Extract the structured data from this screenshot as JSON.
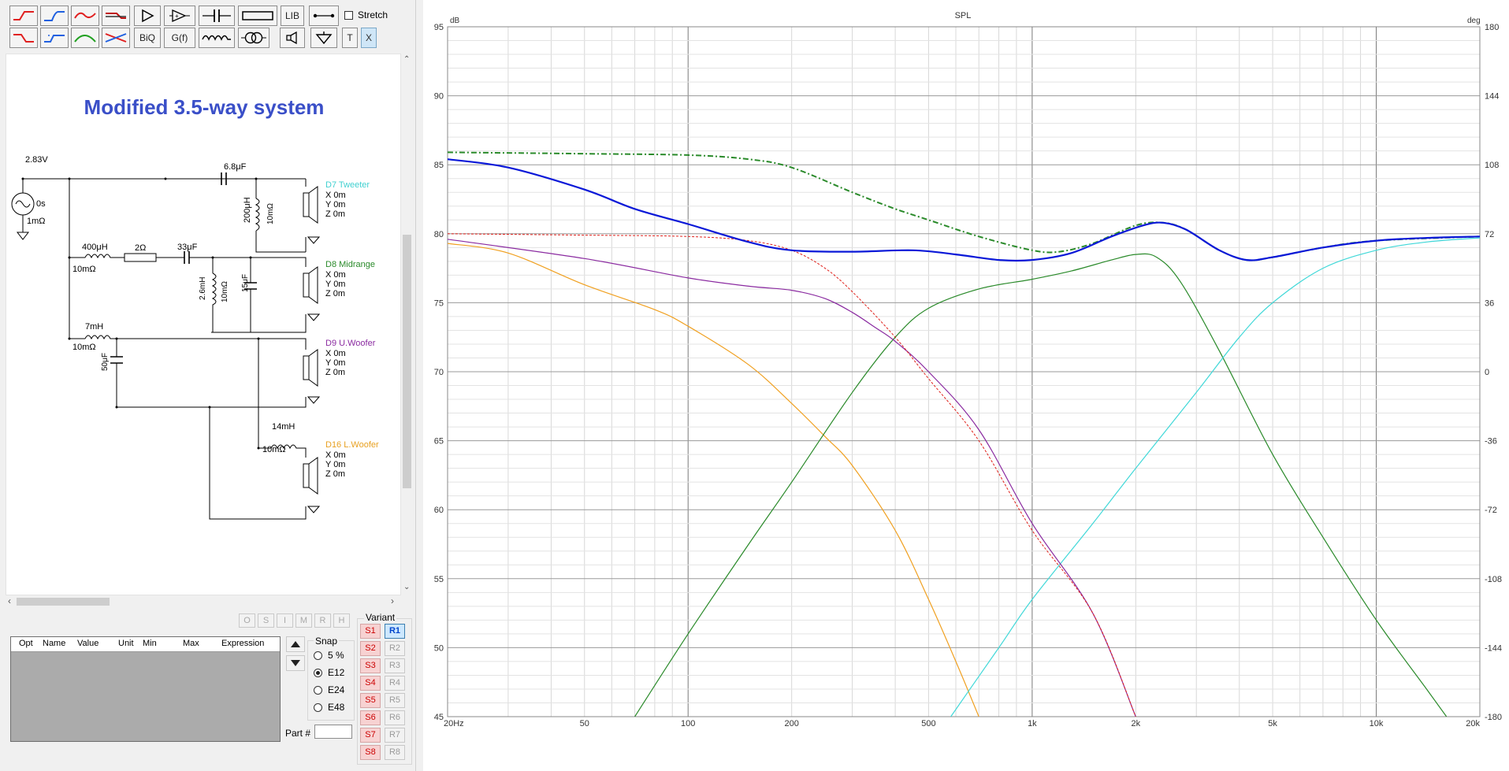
{
  "toolbar": {
    "stretch_label": "Stretch",
    "lib_label": "LIB",
    "biq_label": "BiQ",
    "gf_label": "G(f)",
    "t_label": "T",
    "x_label": "X",
    "row1_icons": [
      "highpass-icon",
      "lowpass-icon",
      "bandpass-icon",
      "shelf-icon",
      "amplifier-icon",
      "buffer-amplifier-icon",
      "capacitor-icon",
      "resistor-icon"
    ],
    "row2_icons": [
      "highpass-2-icon",
      "lowpass-2-icon",
      "bandpass-2-icon",
      "notch-icon"
    ]
  },
  "schematic": {
    "title": "Modified 3.5-way system",
    "source_voltage": "2.83V",
    "source_delay": "0s",
    "source_resistance": "1mΩ",
    "tweeter": {
      "cap": "6.8μF",
      "ind": "200μH",
      "ind_r": "10mΩ",
      "driver": "D7 Tweeter",
      "x": "X 0m",
      "y": "Y 0m",
      "z": "Z 0m",
      "color": "#40d0d0"
    },
    "midrange": {
      "ind": "400μH",
      "ind_r": "10mΩ",
      "res": "2Ω",
      "cap": "33μF",
      "shunt_ind": "2.6mH",
      "shunt_ind_r": "10mΩ",
      "shunt_cap": "15μF",
      "driver": "D8 Midrange",
      "x": "X 0m",
      "y": "Y 0m",
      "z": "Z 0m",
      "color": "#2a8a2a"
    },
    "uwoofer": {
      "ind": "7mH",
      "ind_r": "10mΩ",
      "cap": "50μF",
      "driver": "D9 U.Woofer",
      "x": "X 0m",
      "y": "Y 0m",
      "z": "Z 0m",
      "color": "#8a2aa0"
    },
    "lwoofer": {
      "ind": "14mH",
      "ind_r": "10mΩ",
      "driver": "D16 L.Woofer",
      "x": "X 0m",
      "y": "Y 0m",
      "z": "Z 0m",
      "color": "#e8a020"
    }
  },
  "lower": {
    "osimrh": [
      "O",
      "S",
      "I",
      "M",
      "R",
      "H"
    ],
    "columns": [
      "Opt",
      "Name",
      "Value",
      "Unit",
      "Min",
      "Max",
      "Expression"
    ],
    "snap_title": "Snap",
    "snap_options": [
      "5 %",
      "E12",
      "E24",
      "E48"
    ],
    "snap_selected": "E12",
    "part_label": "Part #",
    "part_value": "",
    "variant_title": "Variant",
    "variants_s": [
      "S1",
      "S2",
      "S3",
      "S4",
      "S5",
      "S6",
      "S7",
      "S8"
    ],
    "variants_r": [
      "R1",
      "R2",
      "R3",
      "R4",
      "R5",
      "R6",
      "R7",
      "R8"
    ],
    "active_variant": "R1"
  },
  "chart_data": {
    "type": "line",
    "title": "SPL",
    "ylabel": "dB",
    "y2label": "deg",
    "xscale": "log",
    "xlim": [
      20,
      20000
    ],
    "ylim": [
      45,
      95
    ],
    "y2lim": [
      -180,
      180
    ],
    "x_ticks": [
      20,
      50,
      100,
      200,
      500,
      1000,
      2000,
      5000,
      10000,
      20000
    ],
    "x_tick_labels": [
      "20Hz",
      "50",
      "100",
      "200",
      "500",
      "1k",
      "2k",
      "5k",
      "10k",
      "20k"
    ],
    "y_ticks": [
      45,
      50,
      55,
      60,
      65,
      70,
      75,
      80,
      85,
      90,
      95
    ],
    "y2_ticks": [
      -180,
      -144,
      -108,
      -72,
      -36,
      0,
      36,
      72,
      108,
      144,
      180
    ],
    "grid": true,
    "series": [
      {
        "color": "#0a18d8",
        "width": 2.2,
        "dash": "",
        "points": [
          [
            20,
            85.4
          ],
          [
            30,
            84.8
          ],
          [
            50,
            83.2
          ],
          [
            70,
            81.8
          ],
          [
            100,
            80.7
          ],
          [
            150,
            79.4
          ],
          [
            200,
            78.8
          ],
          [
            300,
            78.7
          ],
          [
            450,
            78.8
          ],
          [
            600,
            78.5
          ],
          [
            800,
            78.1
          ],
          [
            1000,
            78.1
          ],
          [
            1300,
            78.6
          ],
          [
            1700,
            79.8
          ],
          [
            2100,
            80.6
          ],
          [
            2400,
            80.8
          ],
          [
            2800,
            80.3
          ],
          [
            3500,
            78.8
          ],
          [
            4200,
            78.1
          ],
          [
            5000,
            78.3
          ],
          [
            7000,
            79.0
          ],
          [
            10000,
            79.5
          ],
          [
            14000,
            79.7
          ],
          [
            20000,
            79.8
          ]
        ]
      },
      {
        "color": "#2a8a2a",
        "width": 2,
        "dash": "7,3,2,3",
        "points": [
          [
            20,
            85.9
          ],
          [
            50,
            85.8
          ],
          [
            100,
            85.7
          ],
          [
            150,
            85.4
          ],
          [
            200,
            84.8
          ],
          [
            300,
            83.0
          ],
          [
            400,
            81.8
          ],
          [
            500,
            81.0
          ],
          [
            700,
            79.8
          ],
          [
            1000,
            78.8
          ],
          [
            1200,
            78.7
          ],
          [
            1500,
            79.3
          ],
          [
            2000,
            80.6
          ],
          [
            2400,
            80.8
          ],
          [
            2800,
            80.3
          ],
          [
            3500,
            78.8
          ],
          [
            4200,
            78.1
          ],
          [
            5000,
            78.3
          ],
          [
            7000,
            79.0
          ],
          [
            10000,
            79.5
          ],
          [
            20000,
            79.8
          ]
        ]
      },
      {
        "color": "#e0201a",
        "width": 1,
        "dash": "3,2",
        "points": [
          [
            20,
            80.0
          ],
          [
            50,
            79.9
          ],
          [
            100,
            79.8
          ],
          [
            150,
            79.5
          ],
          [
            200,
            78.8
          ],
          [
            250,
            77.5
          ],
          [
            300,
            75.8
          ],
          [
            400,
            72.5
          ],
          [
            500,
            69.5
          ],
          [
            700,
            65.0
          ],
          [
            1000,
            58.5
          ],
          [
            1500,
            52.5
          ],
          [
            2000,
            45
          ]
        ]
      },
      {
        "color": "#8a2aa0",
        "width": 1.2,
        "dash": "",
        "points": [
          [
            20,
            79.6
          ],
          [
            50,
            78.2
          ],
          [
            100,
            76.8
          ],
          [
            150,
            76.2
          ],
          [
            200,
            75.9
          ],
          [
            250,
            75.3
          ],
          [
            300,
            74.3
          ],
          [
            350,
            73.2
          ],
          [
            400,
            72.2
          ],
          [
            500,
            70.0
          ],
          [
            700,
            65.8
          ],
          [
            1000,
            59.0
          ],
          [
            1500,
            52.5
          ],
          [
            2000,
            45
          ]
        ]
      },
      {
        "color": "#f0a020",
        "width": 1.2,
        "dash": "",
        "points": [
          [
            20,
            79.3
          ],
          [
            30,
            78.6
          ],
          [
            50,
            76.3
          ],
          [
            80,
            74.5
          ],
          [
            100,
            73.3
          ],
          [
            150,
            70.5
          ],
          [
            200,
            67.7
          ],
          [
            250,
            65.3
          ],
          [
            300,
            63.2
          ],
          [
            400,
            58.5
          ],
          [
            500,
            53.5
          ],
          [
            600,
            49.0
          ],
          [
            700,
            45
          ]
        ]
      },
      {
        "color": "#2a8a2a",
        "width": 1.2,
        "dash": "",
        "points": [
          [
            70,
            45
          ],
          [
            100,
            51.0
          ],
          [
            150,
            57.5
          ],
          [
            200,
            62.0
          ],
          [
            300,
            68.5
          ],
          [
            400,
            72.5
          ],
          [
            500,
            74.6
          ],
          [
            700,
            76.0
          ],
          [
            1000,
            76.7
          ],
          [
            1300,
            77.3
          ],
          [
            1700,
            78.1
          ],
          [
            2000,
            78.5
          ],
          [
            2300,
            78.3
          ],
          [
            2700,
            76.5
          ],
          [
            3500,
            71.5
          ],
          [
            5000,
            64.0
          ],
          [
            7000,
            58.0
          ],
          [
            10000,
            52.0
          ],
          [
            14000,
            47.0
          ],
          [
            16000,
            45
          ]
        ]
      },
      {
        "color": "#40d8d8",
        "width": 1.2,
        "dash": "",
        "points": [
          [
            580,
            45
          ],
          [
            800,
            50.0
          ],
          [
            1000,
            53.5
          ],
          [
            1500,
            59.0
          ],
          [
            2000,
            63.0
          ],
          [
            3000,
            68.5
          ],
          [
            4000,
            72.5
          ],
          [
            5000,
            75.0
          ],
          [
            7000,
            77.5
          ],
          [
            10000,
            78.8
          ],
          [
            14000,
            79.4
          ],
          [
            20000,
            79.7
          ]
        ]
      }
    ]
  }
}
